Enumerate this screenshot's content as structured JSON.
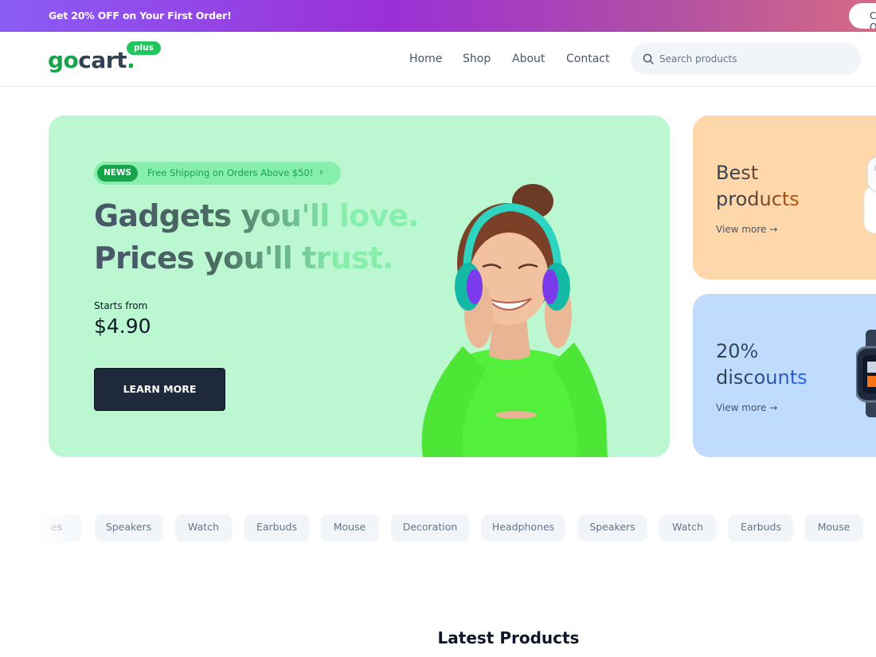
{
  "promo": {
    "text": "Get 20% OFF on Your First Order!",
    "button_label": "Claim Offer"
  },
  "header": {
    "logo": {
      "go": "go",
      "cart": "cart",
      "dot": ".",
      "badge": "plus"
    },
    "nav": [
      "Home",
      "Shop",
      "About",
      "Contact"
    ],
    "search_placeholder": "Search products"
  },
  "hero": {
    "news_tag": "NEWS",
    "news_text": "Free Shipping on Orders Above $50!",
    "title_line1": "Gadgets you'll love.",
    "title_line2": "Prices you'll trust.",
    "starts_label": "Starts from",
    "price": "$4.90",
    "cta": "LEARN MORE"
  },
  "side_cards": [
    {
      "line1": "Best",
      "line2": "products",
      "link": "View more"
    },
    {
      "line1": "20%",
      "line2": "discounts",
      "link": "View more"
    }
  ],
  "categories": [
    "es",
    "Speakers",
    "Watch",
    "Earbuds",
    "Mouse",
    "Decoration",
    "Headphones",
    "Speakers",
    "Watch",
    "Earbuds",
    "Mouse"
  ],
  "section_title": "Latest Products",
  "colors": {
    "brand_green": "#16a34a",
    "hero_bg": "#bbf7d0",
    "best_bg": "#fed7aa",
    "discount_bg": "#bfdbfe",
    "dark_button": "#1e293b"
  }
}
